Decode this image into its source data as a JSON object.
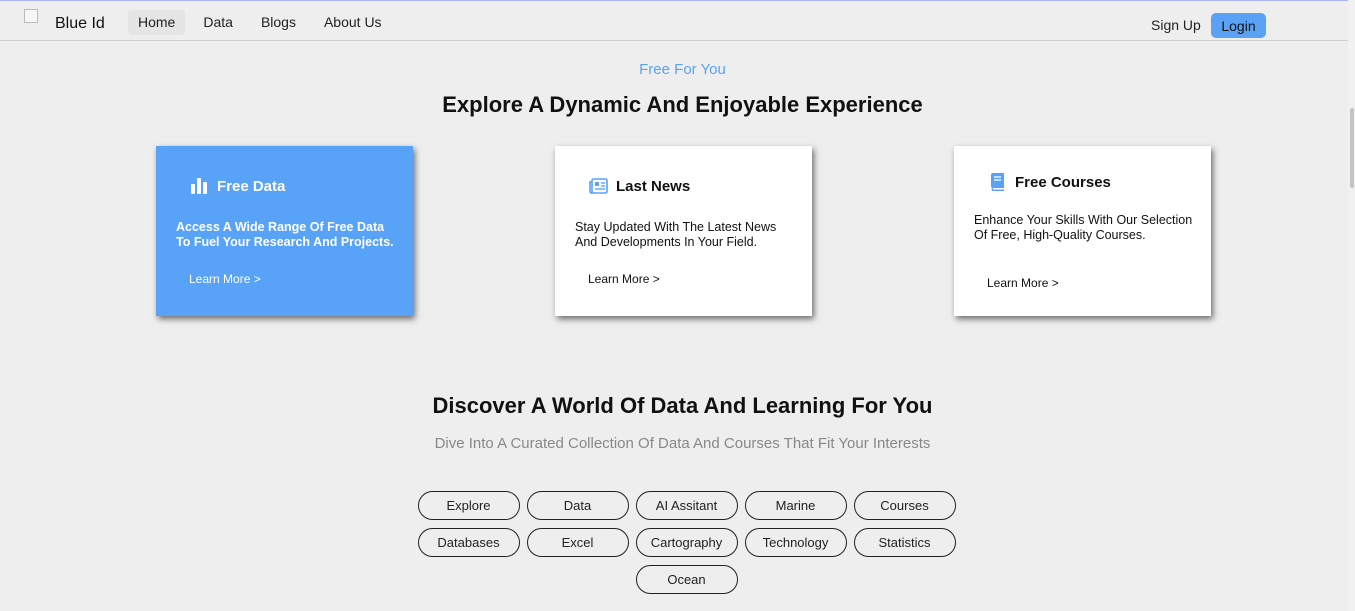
{
  "brand": {
    "name": "Blue Id"
  },
  "nav": {
    "links": [
      "Home",
      "Data",
      "Blogs",
      "About Us"
    ],
    "active": "Home",
    "signup_label": "Sign Up",
    "login_label": "Login"
  },
  "hero": {
    "eyebrow": "Free For You",
    "headline": "Explore A Dynamic And Enjoyable Experience"
  },
  "cards": [
    {
      "icon": "bar-chart-icon",
      "title": "Free Data",
      "description": "Access A Wide Range Of Free Data To Fuel Your Research And Projects.",
      "link": "Learn More >"
    },
    {
      "icon": "newspaper-icon",
      "title": "Last News",
      "description": "Stay Updated With The Latest News And Developments In Your Field.",
      "link": "Learn More >"
    },
    {
      "icon": "book-icon",
      "title": "Free Courses",
      "description": "Enhance Your Skills With Our Selection Of Free, High-Quality Courses.",
      "link": "Learn More >"
    }
  ],
  "discover": {
    "title": "Discover A World Of Data And Learning For You",
    "subtitle": "Dive Into A Curated Collection Of Data And Courses That Fit Your Interests",
    "tags": [
      "Explore",
      "Data",
      "AI Assitant",
      "Marine",
      "Courses",
      "Databases",
      "Excel",
      "Cartography",
      "Technology",
      "Statistics",
      "Ocean"
    ]
  },
  "colors": {
    "accent": "#5aa2f5",
    "background": "#eeeeee",
    "card": "#ffffff"
  }
}
